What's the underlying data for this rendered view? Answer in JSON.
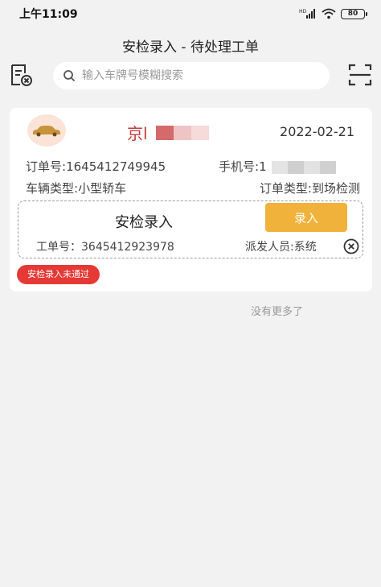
{
  "status_bar": {
    "time": "上午11:09",
    "battery": "80",
    "icons": [
      "hd-signal-icon",
      "wifi-icon",
      "battery-icon"
    ]
  },
  "page": {
    "title": "安检录入 - 待处理工单"
  },
  "search": {
    "placeholder": "输入车牌号模糊搜索",
    "value": ""
  },
  "order": {
    "plate": "京l",
    "date": "2022-02-21",
    "order_number_label": "订单号:",
    "order_number": "1645412749945",
    "phone_label": "手机号:",
    "phone": "1",
    "vehicle_type_label": "车辆类型:",
    "vehicle_type": "小型轿车",
    "order_type_label": "订单类型:",
    "order_type": "到场检测",
    "task": {
      "title": "安检录入",
      "enter_button": "录入",
      "work_order_label": "工单号：",
      "work_order": "3645412923978",
      "dispatcher_label": "派发人员:",
      "dispatcher": "系统"
    },
    "status_badge": "安检录入未通过"
  },
  "list_end_text": "没有更多了",
  "colors": {
    "background": "#f2f2f2",
    "plate_red": "#c23b3b",
    "accent_orange": "#f0b23a",
    "badge_red": "#e53935"
  }
}
